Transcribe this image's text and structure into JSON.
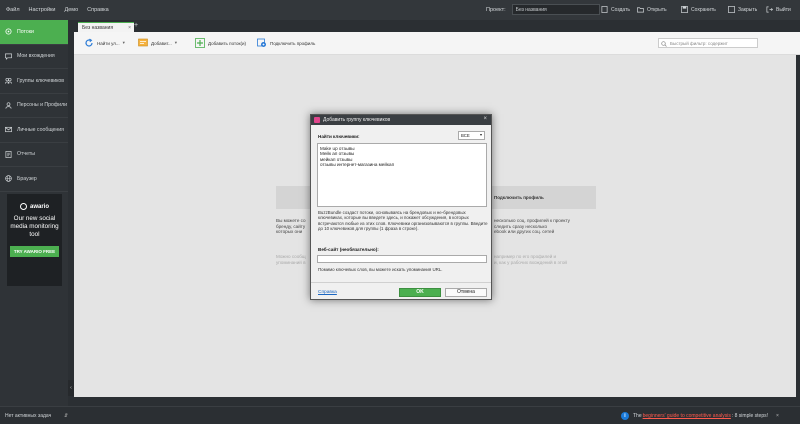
{
  "menu": [
    "Файл",
    "Настройки",
    "Демо",
    "Справка"
  ],
  "project": {
    "label": "Проект:",
    "value": "Без названия"
  },
  "top_buttons": {
    "create": "Создать",
    "open": "Открыть",
    "save": "Сохранить",
    "close": "Закрыть",
    "exit": "Выйти"
  },
  "sidebar": {
    "items": [
      {
        "label": "Потоки",
        "icon": "stream-icon",
        "active": true
      },
      {
        "label": "Мои вхождения",
        "icon": "comments-icon"
      },
      {
        "label": "Группы ключевиков",
        "icon": "groups-icon"
      },
      {
        "label": "Персоны и Профили",
        "icon": "people-icon"
      },
      {
        "label": "Личные сообщения",
        "icon": "mail-icon"
      },
      {
        "label": "Отчеты",
        "icon": "report-icon"
      },
      {
        "label": "Браузер",
        "icon": "globe-icon"
      }
    ],
    "collapse": "‹"
  },
  "ad": {
    "brand": "awario",
    "text": "Our new social media monitoring tool",
    "button": "TRY AWARIO FREE"
  },
  "tab": {
    "label": "Без названия",
    "close": "×",
    "add": "+"
  },
  "toolbar": {
    "find": "Найти ул...",
    "add": "Добавит...",
    "add_streams": "Добавить поток(и)",
    "connect_profile": "Подключить профиль",
    "filter_placeholder": "Быстрый фильтр: содержит"
  },
  "background": {
    "connect_profile": "Подключить профиль",
    "left_text": "Вы можете со\nбренду, сайту\nкоторых они ",
    "left_faint": "Можно сообщ\nупоминаний в",
    "right_text": "несколько соц. профилей к проекту\nследить сразу несколько\nebook или других соц. сетей",
    "right_faint": "например по его профилей и\nи, как у рабочих вхождений в этой"
  },
  "dialog": {
    "title": "Добавить группу ключевиков",
    "close": "×",
    "keywords_label": "Найти ключевики:",
    "mode": "ВСЕ",
    "keywords": [
      "Make up отзывы",
      "Мейк ап отзывы",
      "мейкап отзывы",
      "отзывы интернет-магазина мейкап"
    ],
    "help1": "BuzzBundle создаст потоки, основываясь на брендовых и не-брендовых ключевиках, которые вы введете здесь, и покажет обсуждения, в которых встречаются любые из этих слов. Ключевики организовываются в группы. Введите до 10 ключевиков для группы (1 фраза в строке).",
    "website_label": "Веб-сайт (необязательно):",
    "website_value": "",
    "help2": "Помимо ключевых слов, вы можете искать упоминания URL.",
    "help_link": "Справка",
    "ok": "OK",
    "cancel": "Отмена"
  },
  "status": {
    "left": "Нет активных задач",
    "mid": "⇵",
    "prefix": "The",
    "link": "beginners' guide to competitive analysis",
    "suffix": ": 8 simple steps!",
    "info": "i",
    "close": "×"
  },
  "colors": {
    "accent": "#4caf50",
    "link": "#1a66c2",
    "promo_link": "#ff5a4d"
  }
}
